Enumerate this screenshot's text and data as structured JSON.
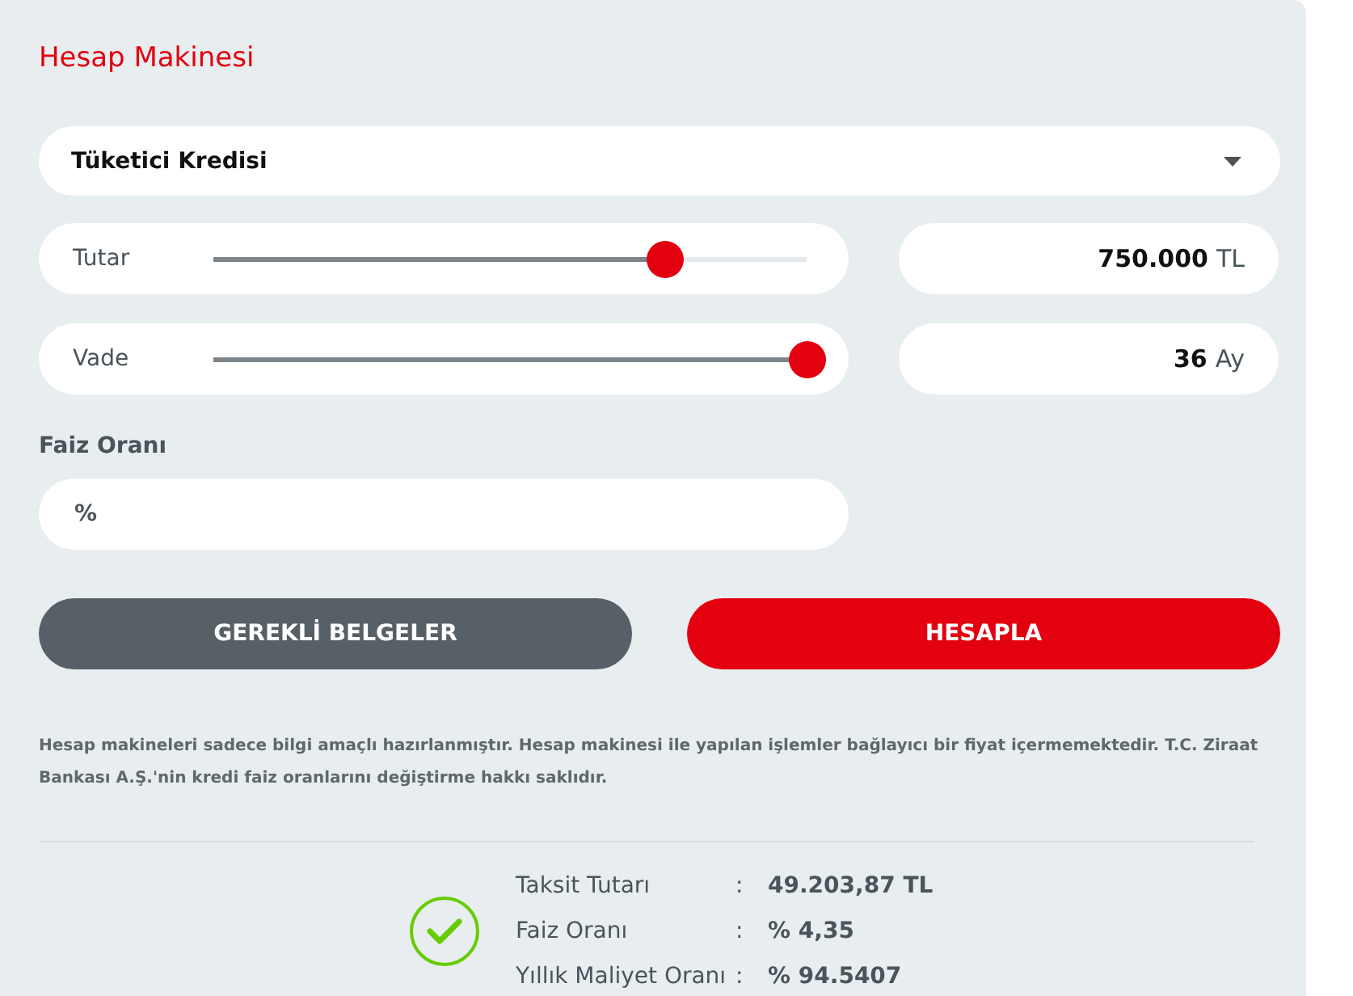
{
  "title": "Hesap Makinesi",
  "product_select": {
    "value": "Tüketici Kredisi"
  },
  "sliders": [
    {
      "label": "Tutar",
      "level": 0.76,
      "value": "750.000",
      "unit": "TL"
    },
    {
      "label": "Vade",
      "level": 1,
      "value": "36",
      "unit": "Ay"
    }
  ],
  "rate": {
    "label": "Faiz Oranı",
    "prefix": "%"
  },
  "buttons": [
    {
      "label": "GEREKLİ BELGELER",
      "kind": "secondary"
    },
    {
      "label": "HESAPLA",
      "kind": "primary"
    }
  ],
  "disclaimer": "Hesap makineleri sadece bilgi amaçlı hazırlanmıştır. Hesap makinesi ile yapılan işlemler bağlayıcı bir fiyat içermemektedir. T.C. Ziraat Bankası A.Ş.'nin kredi faiz oranlarını değiştirme hakkı saklıdır.",
  "results": [
    {
      "label": "Taksit Tutarı",
      "separator": ":",
      "value": "49.203,87 TL"
    },
    {
      "label": "Faiz Oranı",
      "separator": ":",
      "value": "% 4,35"
    },
    {
      "label": "Yıllık Maliyet Oranı",
      "separator": ":",
      "value": "% 94.5407"
    }
  ]
}
